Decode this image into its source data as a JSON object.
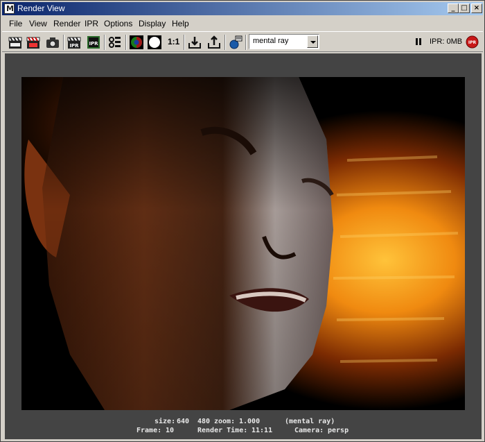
{
  "window": {
    "title": "Render View"
  },
  "menu": {
    "items": [
      "File",
      "View",
      "Render",
      "IPR",
      "Options",
      "Display",
      "Help"
    ]
  },
  "toolbar": {
    "ratio_label": "1:1",
    "renderer_selected": "mental ray",
    "ipr_status": "IPR: 0MB",
    "ipr_badge": "IPR",
    "ipr_icon_label": "IPR"
  },
  "info": {
    "size_label": "size:",
    "width": "640",
    "height": "480",
    "zoom_label": "zoom:",
    "zoom": "1.000",
    "renderer": "(mental ray)",
    "frame_label": "Frame:",
    "frame": "10",
    "render_time_label": "Render Time:",
    "render_time": "11:11",
    "camera_label": "Camera:",
    "camera": "persp"
  }
}
